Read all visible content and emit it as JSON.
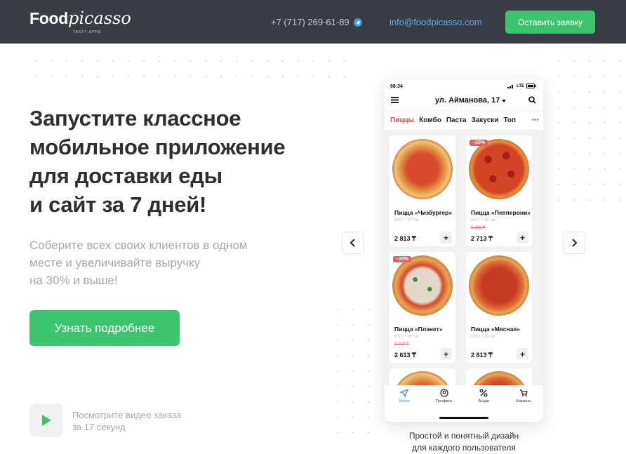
{
  "header": {
    "logo_bold": "Food",
    "logo_script": "picasso",
    "logo_tagline": "TASTY APPS",
    "phone": "+7 (717) 269-61-89",
    "email": "info@foodpicasso.com",
    "cta_label": "Оставить заявку"
  },
  "hero": {
    "headline_lines": [
      "Запустите классное",
      "мобильное приложение",
      "для доставки еды",
      "и сайт за 7 дней!"
    ],
    "subtext_lines": [
      "Соберите всех своих клиентов в одном",
      "месте и увеличивайте выручку",
      "на 30% и выше!"
    ],
    "cta_label": "Узнать подробнее",
    "video_lines": [
      "Посмотрите видео заказа",
      "за 17 секунд"
    ]
  },
  "phone_mock": {
    "time": "08:34",
    "network": "LTE",
    "address": "ул. Айманова, 17",
    "categories": [
      "Пиццы",
      "Комбо",
      "Паста",
      "Закуски",
      "Топ"
    ],
    "active_category": "Пиццы",
    "products": [
      {
        "name": "Пицца «Чизбургер»",
        "meta": "650 г / 30 см",
        "old_price": "",
        "price": "2 813 ₸",
        "badge": ""
      },
      {
        "name": "Пицца «Пепперони»",
        "meta": "650 г / 30 см",
        "old_price": "3 290 ₸",
        "price": "2 713 ₸",
        "badge": "−20%"
      },
      {
        "name": "Пицца «Плэнет»",
        "meta": "650 г / 30 см",
        "old_price": "3 000 ₸",
        "price": "2 613 ₸",
        "badge": "−20%"
      },
      {
        "name": "Пицца «Мясная»",
        "meta": "650 г / 30 см",
        "old_price": "",
        "price": "2 813 ₸",
        "badge": ""
      }
    ],
    "add_label": "+",
    "tabs": [
      "Меню",
      "Профиль",
      "Акции",
      "Корзина"
    ],
    "active_tab": "Меню"
  },
  "caption_lines": [
    "Простой и понятный дизайн",
    "для каждого пользователя"
  ],
  "colors": {
    "header_bg": "#3a3c43",
    "accent_green": "#3cc46e",
    "link_blue": "#55adf0",
    "sale_red": "#ef5a5a"
  }
}
